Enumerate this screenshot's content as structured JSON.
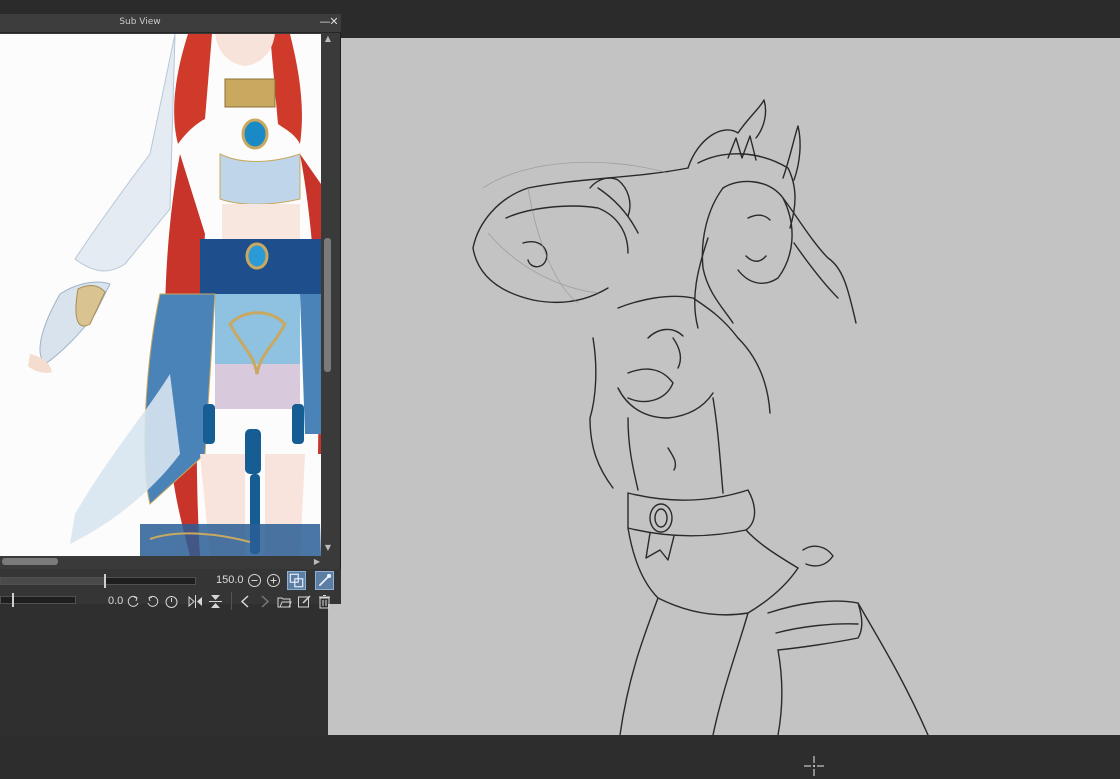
{
  "subview": {
    "title": "Sub View",
    "minimize_glyph": "—",
    "close_glyph": "✕",
    "zoom": "150.0",
    "rotation": "0.0",
    "icons": {
      "zoom_out": "zoom-out-icon",
      "zoom_in": "zoom-in-icon",
      "fit": "fit-to-view-icon",
      "eyedropper": "eyedropper-icon",
      "rotate_left": "rotate-left-icon",
      "rotate_right": "rotate-right-icon",
      "reset_rotation": "reset-rotation-icon",
      "flip_h": "flip-horizontal-icon",
      "flip_v": "flip-vertical-icon",
      "prev": "previous-image-icon",
      "next": "next-image-icon",
      "import": "import-image-icon",
      "edit": "edit-icon",
      "delete": "trash-icon"
    }
  },
  "colors": {
    "canvas": "#c3c3c3",
    "app_background": "#2f2f2f",
    "palette_background": "#3a3a3a",
    "active_button": "#5d7ea3"
  }
}
